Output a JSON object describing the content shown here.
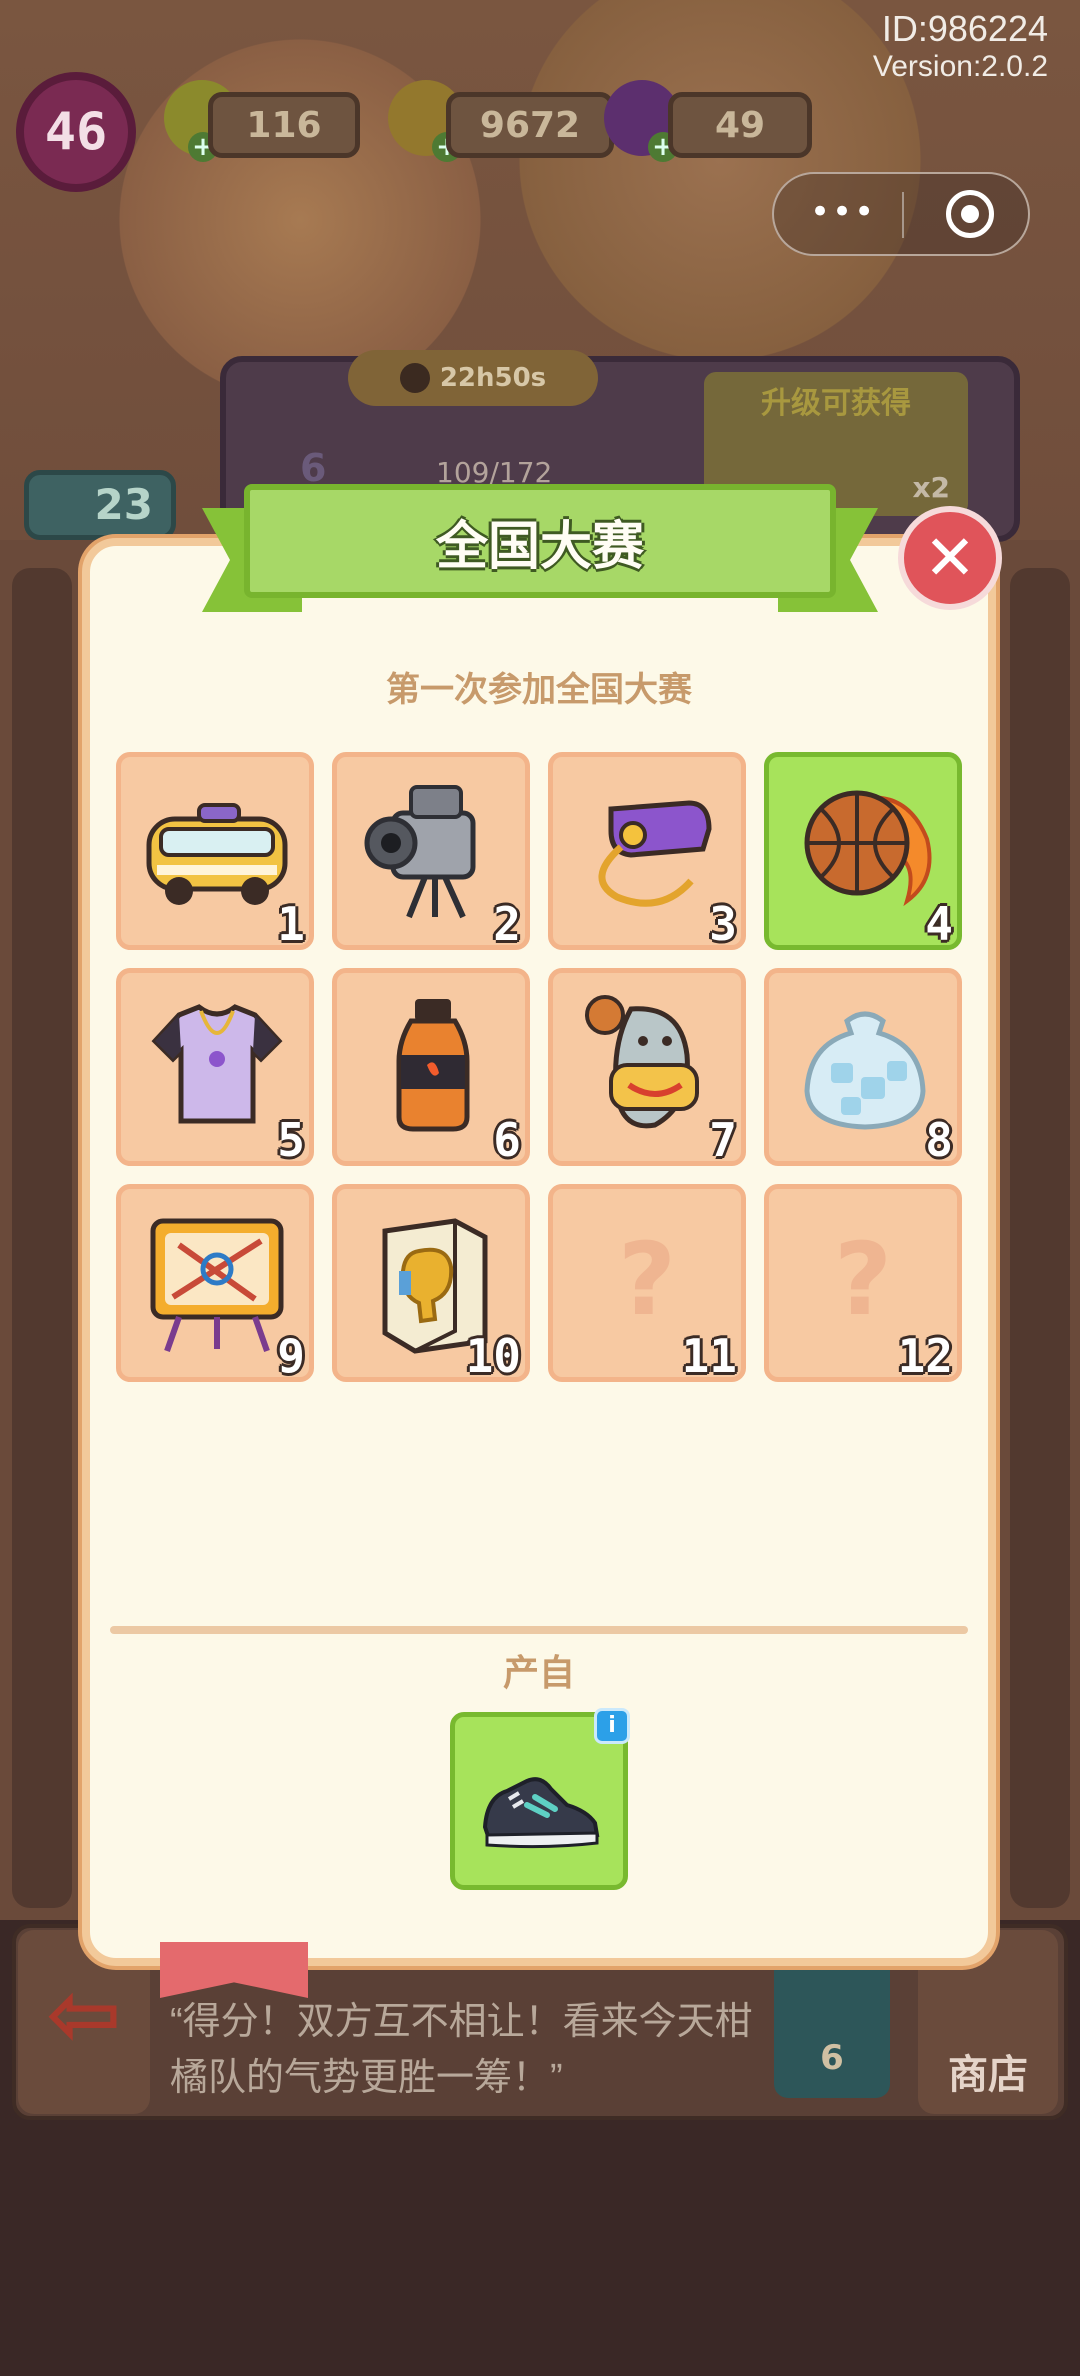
{
  "player": {
    "id_text": "ID:986224",
    "version_text": "Version:2.0.2"
  },
  "hud": {
    "level": "46",
    "energy": "116",
    "coins": "9672",
    "gems": "49"
  },
  "background": {
    "timer": "22h50s",
    "upgrade_title": "升级可获得",
    "upgrade_reward_count": "x2",
    "level_badge": "6",
    "xp_text": "109/172",
    "star_count": "23",
    "commentary": "“得分！双方互不相让！看来今天柑橘队的气势更胜一筹！”",
    "coin_count": "6",
    "shop_label": "商店"
  },
  "modal": {
    "title": "全国大赛",
    "subtitle": "第一次参加全国大赛",
    "source_label": "产自",
    "info_glyph": "i",
    "items": [
      {
        "num": "1",
        "icon": "bus-icon",
        "unlocked": true,
        "active": false
      },
      {
        "num": "2",
        "icon": "video-camera-icon",
        "unlocked": true,
        "active": false
      },
      {
        "num": "3",
        "icon": "whistle-icon",
        "unlocked": true,
        "active": false
      },
      {
        "num": "4",
        "icon": "fire-basketball-icon",
        "unlocked": true,
        "active": true
      },
      {
        "num": "5",
        "icon": "jersey-icon",
        "unlocked": true,
        "active": false
      },
      {
        "num": "6",
        "icon": "sports-drink-icon",
        "unlocked": true,
        "active": false
      },
      {
        "num": "7",
        "icon": "mascot-icon",
        "unlocked": true,
        "active": false
      },
      {
        "num": "8",
        "icon": "ice-bag-icon",
        "unlocked": true,
        "active": false
      },
      {
        "num": "9",
        "icon": "tactics-board-icon",
        "unlocked": true,
        "active": false
      },
      {
        "num": "10",
        "icon": "trophy-cabinet-icon",
        "unlocked": true,
        "active": false
      },
      {
        "num": "11",
        "icon": "question-mark-icon",
        "unlocked": false,
        "active": false,
        "placeholder": "?"
      },
      {
        "num": "12",
        "icon": "question-mark-icon",
        "unlocked": false,
        "active": false,
        "placeholder": "?"
      }
    ],
    "source_item_icon": "sneaker-icon"
  },
  "colors": {
    "panel": "#fdf9e8",
    "ribbon": "#a7d867",
    "slot": "#f7c9a2",
    "slot_active": "#a7e35b",
    "close": "#e0545a",
    "label": "#c79a6b"
  }
}
